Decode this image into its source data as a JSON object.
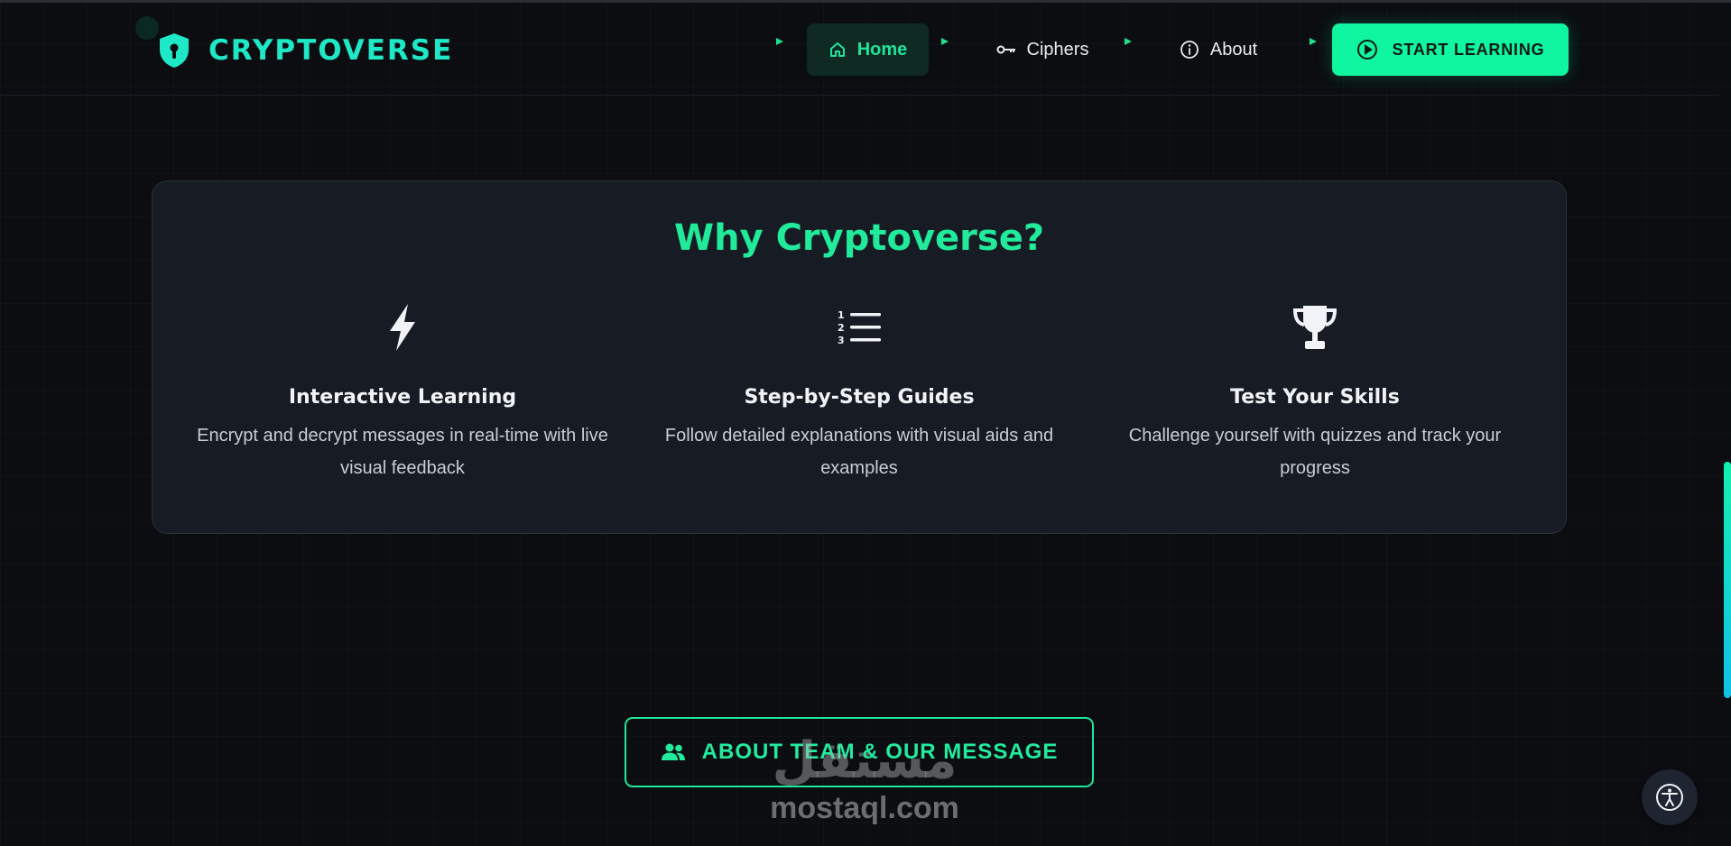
{
  "brand": {
    "name": "CRYPTOVERSE",
    "icon": "shield-keyhole-icon"
  },
  "nav": {
    "items": [
      {
        "label": "Home",
        "icon": "home-icon",
        "active": true
      },
      {
        "label": "Ciphers",
        "icon": "key-icon",
        "active": false
      },
      {
        "label": "About",
        "icon": "info-icon",
        "active": false
      }
    ],
    "cta": {
      "label": "START LEARNING",
      "icon": "play-circle-icon"
    }
  },
  "why": {
    "title": "Why Cryptoverse?",
    "features": [
      {
        "icon": "lightning-icon",
        "title": "Interactive Learning",
        "description": "Encrypt and decrypt messages in real-time with live visual feedback"
      },
      {
        "icon": "numbered-list-icon",
        "title": "Step-by-Step Guides",
        "description": "Follow detailed explanations with visual aids and examples"
      },
      {
        "icon": "trophy-icon",
        "title": "Test Your Skills",
        "description": "Challenge yourself with quizzes and track your progress"
      }
    ]
  },
  "about_button": {
    "label": "ABOUT TEAM & OUR MESSAGE",
    "icon": "users-icon"
  },
  "watermark": {
    "arabic": "مستقل",
    "latin": "mostaql.com"
  },
  "colors": {
    "accent": "#10f5a0",
    "brand": "#1ee8c6",
    "background": "#0b0d11",
    "card": "#161b24"
  }
}
